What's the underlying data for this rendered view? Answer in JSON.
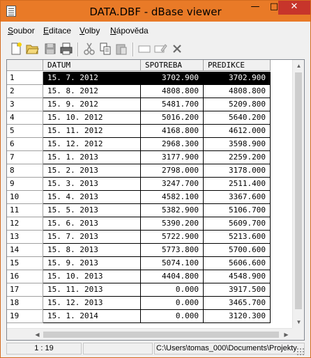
{
  "window": {
    "title": "DATA.DBF - dBase viewer",
    "controls": {
      "minimize": "—",
      "maximize": "□",
      "close": "✕"
    }
  },
  "menu": [
    {
      "label": "Soubor",
      "accel": "S",
      "rest": "oubor"
    },
    {
      "label": "Editace",
      "accel": "E",
      "rest": "ditace"
    },
    {
      "label": "Volby",
      "accel": "V",
      "rest": "olby"
    },
    {
      "label": "Nápověda",
      "accel": "N",
      "rest": "ápověda"
    }
  ],
  "toolbar": {
    "icons": [
      "new-file-icon",
      "open-folder-icon",
      "save-icon",
      "print-icon",
      "cut-icon",
      "copy-icon",
      "paste-icon",
      "insert-record-icon",
      "edit-record-icon",
      "delete-icon"
    ]
  },
  "table": {
    "columns": [
      "",
      "DATUM",
      "SPOTREBA",
      "PREDIKCE"
    ],
    "selected_row": 1,
    "rows": [
      {
        "n": "1",
        "datum": "15. 7. 2012",
        "spotreba": "3702.900",
        "predikce": "3702.900"
      },
      {
        "n": "2",
        "datum": "15. 8. 2012",
        "spotreba": "4808.800",
        "predikce": "4808.800"
      },
      {
        "n": "3",
        "datum": "15. 9. 2012",
        "spotreba": "5481.700",
        "predikce": "5209.800"
      },
      {
        "n": "4",
        "datum": "15. 10. 2012",
        "spotreba": "5016.200",
        "predikce": "5640.200"
      },
      {
        "n": "5",
        "datum": "15. 11. 2012",
        "spotreba": "4168.800",
        "predikce": "4612.000"
      },
      {
        "n": "6",
        "datum": "15. 12. 2012",
        "spotreba": "2968.300",
        "predikce": "3598.900"
      },
      {
        "n": "7",
        "datum": "15. 1. 2013",
        "spotreba": "3177.900",
        "predikce": "2259.200"
      },
      {
        "n": "8",
        "datum": "15. 2. 2013",
        "spotreba": "2798.000",
        "predikce": "3178.000"
      },
      {
        "n": "9",
        "datum": "15. 3. 2013",
        "spotreba": "3247.700",
        "predikce": "2511.400"
      },
      {
        "n": "10",
        "datum": "15. 4. 2013",
        "spotreba": "4582.100",
        "predikce": "3367.600"
      },
      {
        "n": "11",
        "datum": "15. 5. 2013",
        "spotreba": "5382.900",
        "predikce": "5106.700"
      },
      {
        "n": "12",
        "datum": "15. 6. 2013",
        "spotreba": "5390.200",
        "predikce": "5609.700"
      },
      {
        "n": "13",
        "datum": "15. 7. 2013",
        "spotreba": "5722.900",
        "predikce": "5213.600"
      },
      {
        "n": "14",
        "datum": "15. 8. 2013",
        "spotreba": "5773.800",
        "predikce": "5700.600"
      },
      {
        "n": "15",
        "datum": "15. 9. 2013",
        "spotreba": "5074.100",
        "predikce": "5606.600"
      },
      {
        "n": "16",
        "datum": "15. 10. 2013",
        "spotreba": "4404.800",
        "predikce": "4548.900"
      },
      {
        "n": "17",
        "datum": "15. 11. 2013",
        "spotreba": "0.000",
        "predikce": "3917.500"
      },
      {
        "n": "18",
        "datum": "15. 12. 2013",
        "spotreba": "0.000",
        "predikce": "3465.700"
      },
      {
        "n": "19",
        "datum": "15. 1. 2014",
        "spotreba": "0.000",
        "predikce": "3120.300"
      }
    ]
  },
  "statusbar": {
    "position": "1 : 19",
    "middle": "",
    "path": "C:\\Users\\tomas_000\\Documents\\Projekty"
  },
  "colors": {
    "titlebar": "#e97a27",
    "close": "#c7352b",
    "selection": "#000000"
  }
}
